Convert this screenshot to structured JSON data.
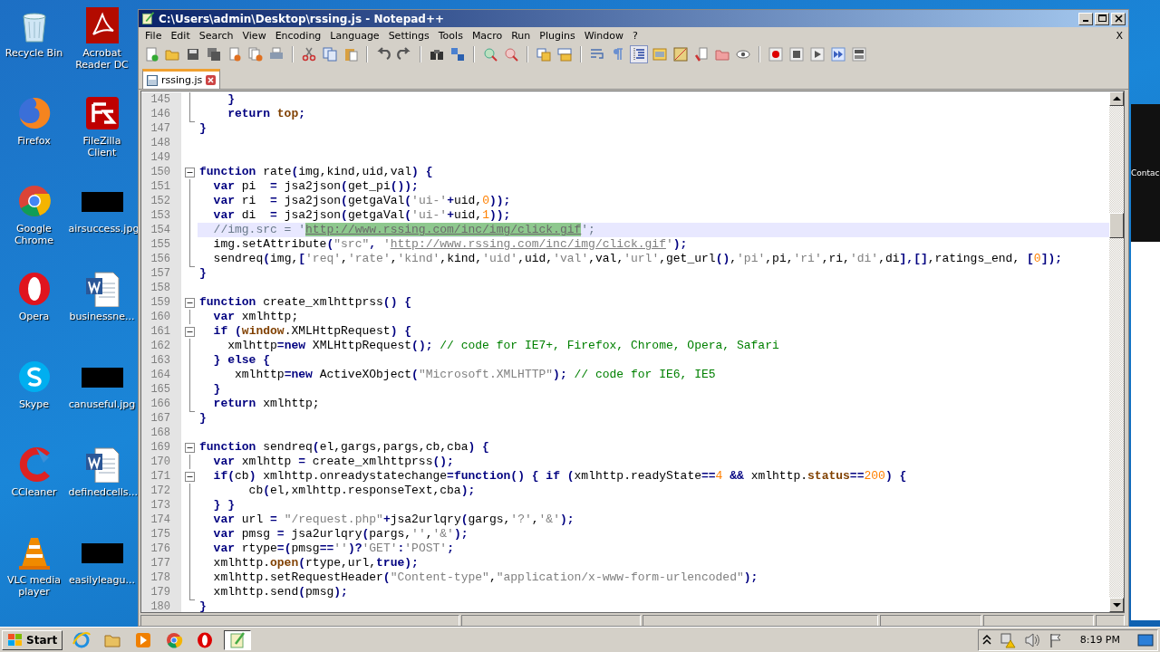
{
  "desktop_icons": [
    {
      "label": "Recycle Bin",
      "kind": "bin"
    },
    {
      "label": "Acrobat Reader DC",
      "kind": "pdf"
    },
    {
      "label": "Firefox",
      "kind": "fox"
    },
    {
      "label": "FileZilla Client",
      "kind": "ftp"
    },
    {
      "label": "Google Chrome",
      "kind": "chrome"
    },
    {
      "label": "airsuccess.jpg",
      "kind": "image"
    },
    {
      "label": "Opera",
      "kind": "opera"
    },
    {
      "label": "businessne...",
      "kind": "doc"
    },
    {
      "label": "Skype",
      "kind": "skype"
    },
    {
      "label": "canuseful.jpg",
      "kind": "image"
    },
    {
      "label": "CCleaner",
      "kind": "cleaner"
    },
    {
      "label": "definedcells...",
      "kind": "doc"
    },
    {
      "label": "VLC media player",
      "kind": "cone"
    },
    {
      "label": "easilyleagu...",
      "kind": "image"
    }
  ],
  "window": {
    "title": "C:\\Users\\admin\\Desktop\\rssing.js - Notepad++"
  },
  "menu": [
    "File",
    "Edit",
    "Search",
    "View",
    "Encoding",
    "Language",
    "Settings",
    "Tools",
    "Macro",
    "Run",
    "Plugins",
    "Window",
    "?"
  ],
  "menu_close": "X",
  "tabs": [
    {
      "label": "rssing.js",
      "selected": true
    }
  ],
  "lines": [
    {
      "num": "145",
      "kind": "tee",
      "current": false,
      "tokens": [
        {
          "kind": "op",
          "text": "    }"
        }
      ]
    },
    {
      "num": "146",
      "kind": "line",
      "current": false,
      "tokens": [
        {
          "kind": "kw",
          "text": "    return"
        },
        {
          "kind": "obj",
          "text": " top"
        },
        {
          "kind": "op",
          "text": ";"
        }
      ]
    },
    {
      "num": "147",
      "kind": "end",
      "current": false,
      "tokens": [
        {
          "kind": "op",
          "text": "}"
        }
      ]
    },
    {
      "num": "148",
      "kind": "none",
      "current": false
    },
    {
      "num": "149",
      "kind": "none",
      "current": false
    },
    {
      "num": "150",
      "kind": "open",
      "current": false,
      "tokens": [
        {
          "kind": "kw",
          "text": "function"
        },
        {
          "kind": "p",
          "text": " rate"
        },
        {
          "kind": "op",
          "text": "("
        },
        {
          "kind": "p",
          "text": "img,kind,uid,val"
        },
        {
          "kind": "op",
          "text": ") {"
        }
      ]
    },
    {
      "num": "151",
      "kind": "line",
      "current": false,
      "tokens": [
        {
          "kind": "kw",
          "text": "  var"
        },
        {
          "kind": "p",
          "text": " pi  "
        },
        {
          "kind": "op",
          "text": "="
        },
        {
          "kind": "p",
          "text": " jsa2json"
        },
        {
          "kind": "op",
          "text": "("
        },
        {
          "kind": "p",
          "text": "get_pi"
        },
        {
          "kind": "op",
          "text": "());"
        }
      ]
    },
    {
      "num": "152",
      "kind": "line",
      "current": false,
      "tokens": [
        {
          "kind": "kw",
          "text": "  var"
        },
        {
          "kind": "p",
          "text": " ri  "
        },
        {
          "kind": "op",
          "text": "="
        },
        {
          "kind": "p",
          "text": " jsa2json"
        },
        {
          "kind": "op",
          "text": "("
        },
        {
          "kind": "p",
          "text": "getgaVal"
        },
        {
          "kind": "op",
          "text": "("
        },
        {
          "kind": "str",
          "text": "'ui-'"
        },
        {
          "kind": "op",
          "text": "+"
        },
        {
          "kind": "p",
          "text": "uid,"
        },
        {
          "kind": "num",
          "text": "0"
        },
        {
          "kind": "op",
          "text": "));"
        }
      ]
    },
    {
      "num": "153",
      "kind": "line",
      "current": false,
      "tokens": [
        {
          "kind": "kw",
          "text": "  var"
        },
        {
          "kind": "p",
          "text": " di  "
        },
        {
          "kind": "op",
          "text": "="
        },
        {
          "kind": "p",
          "text": " jsa2json"
        },
        {
          "kind": "op",
          "text": "("
        },
        {
          "kind": "p",
          "text": "getgaVal"
        },
        {
          "kind": "op",
          "text": "("
        },
        {
          "kind": "str",
          "text": "'ui-'"
        },
        {
          "kind": "op",
          "text": "+"
        },
        {
          "kind": "p",
          "text": "uid,"
        },
        {
          "kind": "num",
          "text": "1"
        },
        {
          "kind": "op",
          "text": "));"
        }
      ]
    },
    {
      "num": "154",
      "kind": "line",
      "current": true,
      "tokens": [
        {
          "kind": "cmt",
          "text": "  //img.src = '"
        },
        {
          "kind": "mark",
          "text": "http://www.rssing.com/inc/img/click.gif"
        },
        {
          "kind": "cmt",
          "text": "';"
        }
      ]
    },
    {
      "num": "155",
      "kind": "line",
      "current": false,
      "tokens": [
        {
          "kind": "p",
          "text": "  img.setAttribute"
        },
        {
          "kind": "op",
          "text": "("
        },
        {
          "kind": "str",
          "text": "\"src\""
        },
        {
          "kind": "op",
          "text": ","
        },
        {
          "kind": "str",
          "text": " '"
        },
        {
          "kind": "url",
          "text": "http://www.rssing.com/inc/img/click.gif"
        },
        {
          "kind": "str",
          "text": "'"
        },
        {
          "kind": "op",
          "text": ");"
        }
      ]
    },
    {
      "num": "156",
      "kind": "line",
      "current": false,
      "tokens": [
        {
          "kind": "p",
          "text": "  sendreq"
        },
        {
          "kind": "op",
          "text": "("
        },
        {
          "kind": "p",
          "text": "img,"
        },
        {
          "kind": "op",
          "text": "["
        },
        {
          "kind": "str",
          "text": "'req'"
        },
        {
          "kind": "p",
          "text": ","
        },
        {
          "kind": "str",
          "text": "'rate'"
        },
        {
          "kind": "p",
          "text": ","
        },
        {
          "kind": "str",
          "text": "'kind'"
        },
        {
          "kind": "p",
          "text": ",kind,"
        },
        {
          "kind": "str",
          "text": "'uid'"
        },
        {
          "kind": "p",
          "text": ",uid,"
        },
        {
          "kind": "str",
          "text": "'val'"
        },
        {
          "kind": "p",
          "text": ",val,"
        },
        {
          "kind": "str",
          "text": "'url'"
        },
        {
          "kind": "p",
          "text": ",get_url"
        },
        {
          "kind": "op",
          "text": "()"
        },
        {
          "kind": "p",
          "text": ","
        },
        {
          "kind": "str",
          "text": "'pi'"
        },
        {
          "kind": "p",
          "text": ",pi,"
        },
        {
          "kind": "str",
          "text": "'ri'"
        },
        {
          "kind": "p",
          "text": ",ri,"
        },
        {
          "kind": "str",
          "text": "'di'"
        },
        {
          "kind": "p",
          "text": ",di"
        },
        {
          "kind": "op",
          "text": "],[]"
        },
        {
          "kind": "p",
          "text": ",ratings_end, "
        },
        {
          "kind": "op",
          "text": "["
        },
        {
          "kind": "num",
          "text": "0"
        },
        {
          "kind": "op",
          "text": "]);"
        }
      ]
    },
    {
      "num": "157",
      "kind": "end",
      "current": false,
      "tokens": [
        {
          "kind": "op",
          "text": "}"
        }
      ]
    },
    {
      "num": "158",
      "kind": "none",
      "current": false
    },
    {
      "num": "159",
      "kind": "open",
      "current": false,
      "tokens": [
        {
          "kind": "kw",
          "text": "function"
        },
        {
          "kind": "p",
          "text": " create_xmlhttprss"
        },
        {
          "kind": "op",
          "text": "() {"
        }
      ]
    },
    {
      "num": "160",
      "kind": "line",
      "current": false,
      "tokens": [
        {
          "kind": "kw",
          "text": "  var"
        },
        {
          "kind": "p",
          "text": " xmlhttp;"
        }
      ]
    },
    {
      "num": "161",
      "kind": "open",
      "current": false,
      "tokens": [
        {
          "kind": "kw",
          "text": "  if"
        },
        {
          "kind": "op",
          "text": " ("
        },
        {
          "kind": "obj",
          "text": "window"
        },
        {
          "kind": "p",
          "text": ".XMLHttpRequest"
        },
        {
          "kind": "op",
          "text": ") {"
        }
      ]
    },
    {
      "num": "162",
      "kind": "line",
      "current": false,
      "tokens": [
        {
          "kind": "p",
          "text": "    xmlhttp"
        },
        {
          "kind": "op",
          "text": "="
        },
        {
          "kind": "kw",
          "text": "new"
        },
        {
          "kind": "p",
          "text": " XMLHttpRequest"
        },
        {
          "kind": "op",
          "text": "();"
        },
        {
          "kind": "cmt",
          "text": " // code for IE7+, Firefox, Chrome, Opera, Safari"
        }
      ]
    },
    {
      "num": "163",
      "kind": "line",
      "current": false,
      "tokens": [
        {
          "kind": "op",
          "text": "  }"
        },
        {
          "kind": "kw",
          "text": " else"
        },
        {
          "kind": "op",
          "text": " {"
        }
      ]
    },
    {
      "num": "164",
      "kind": "line",
      "current": false,
      "tokens": [
        {
          "kind": "p",
          "text": "     xmlhttp"
        },
        {
          "kind": "op",
          "text": "="
        },
        {
          "kind": "kw",
          "text": "new"
        },
        {
          "kind": "p",
          "text": " ActiveXObject"
        },
        {
          "kind": "op",
          "text": "("
        },
        {
          "kind": "str",
          "text": "\"Microsoft.XMLHTTP\""
        },
        {
          "kind": "op",
          "text": ");"
        },
        {
          "kind": "cmt",
          "text": " // code for IE6, IE5"
        }
      ]
    },
    {
      "num": "165",
      "kind": "tee",
      "current": false,
      "tokens": [
        {
          "kind": "op",
          "text": "  }"
        }
      ]
    },
    {
      "num": "166",
      "kind": "line",
      "current": false,
      "tokens": [
        {
          "kind": "kw",
          "text": "  return"
        },
        {
          "kind": "p",
          "text": " xmlhttp;"
        }
      ]
    },
    {
      "num": "167",
      "kind": "end",
      "current": false,
      "tokens": [
        {
          "kind": "op",
          "text": "}"
        }
      ]
    },
    {
      "num": "168",
      "kind": "none",
      "current": false
    },
    {
      "num": "169",
      "kind": "open",
      "current": false,
      "tokens": [
        {
          "kind": "kw",
          "text": "function"
        },
        {
          "kind": "p",
          "text": " sendreq"
        },
        {
          "kind": "op",
          "text": "("
        },
        {
          "kind": "p",
          "text": "el,gargs,pargs,cb,cba"
        },
        {
          "kind": "op",
          "text": ") {"
        }
      ]
    },
    {
      "num": "170",
      "kind": "line",
      "current": false,
      "tokens": [
        {
          "kind": "kw",
          "text": "  var"
        },
        {
          "kind": "p",
          "text": " xmlhttp "
        },
        {
          "kind": "op",
          "text": "="
        },
        {
          "kind": "p",
          "text": " create_xmlhttprss"
        },
        {
          "kind": "op",
          "text": "();"
        }
      ]
    },
    {
      "num": "171",
      "kind": "open",
      "current": false,
      "tokens": [
        {
          "kind": "kw",
          "text": "  if"
        },
        {
          "kind": "op",
          "text": "("
        },
        {
          "kind": "p",
          "text": "cb"
        },
        {
          "kind": "op",
          "text": ")"
        },
        {
          "kind": "p",
          "text": " xmlhttp.onreadystatechange"
        },
        {
          "kind": "op",
          "text": "="
        },
        {
          "kind": "kw",
          "text": "function"
        },
        {
          "kind": "op",
          "text": "() {"
        },
        {
          "kind": "kw",
          "text": " if"
        },
        {
          "kind": "op",
          "text": " ("
        },
        {
          "kind": "p",
          "text": "xmlhttp.readyState"
        },
        {
          "kind": "op",
          "text": "=="
        },
        {
          "kind": "num",
          "text": "4"
        },
        {
          "kind": "op",
          "text": " &&"
        },
        {
          "kind": "p",
          "text": " xmlhttp."
        },
        {
          "kind": "obj",
          "text": "status"
        },
        {
          "kind": "op",
          "text": "=="
        },
        {
          "kind": "num",
          "text": "200"
        },
        {
          "kind": "op",
          "text": ") {"
        }
      ]
    },
    {
      "num": "172",
      "kind": "line",
      "current": false,
      "tokens": [
        {
          "kind": "p",
          "text": "       cb"
        },
        {
          "kind": "op",
          "text": "("
        },
        {
          "kind": "p",
          "text": "el,xmlhttp.responseText,cba"
        },
        {
          "kind": "op",
          "text": ");"
        }
      ]
    },
    {
      "num": "173",
      "kind": "tee",
      "current": false,
      "tokens": [
        {
          "kind": "op",
          "text": "  } }"
        }
      ]
    },
    {
      "num": "174",
      "kind": "line",
      "current": false,
      "tokens": [
        {
          "kind": "kw",
          "text": "  var"
        },
        {
          "kind": "p",
          "text": " url "
        },
        {
          "kind": "op",
          "text": "="
        },
        {
          "kind": "str",
          "text": " \"/request.php\""
        },
        {
          "kind": "op",
          "text": "+"
        },
        {
          "kind": "p",
          "text": "jsa2urlqry"
        },
        {
          "kind": "op",
          "text": "("
        },
        {
          "kind": "p",
          "text": "gargs,"
        },
        {
          "kind": "str",
          "text": "'?'"
        },
        {
          "kind": "p",
          "text": ","
        },
        {
          "kind": "str",
          "text": "'&'"
        },
        {
          "kind": "op",
          "text": ");"
        }
      ]
    },
    {
      "num": "175",
      "kind": "line",
      "current": false,
      "tokens": [
        {
          "kind": "kw",
          "text": "  var"
        },
        {
          "kind": "p",
          "text": " pmsg "
        },
        {
          "kind": "op",
          "text": "="
        },
        {
          "kind": "p",
          "text": " jsa2urlqry"
        },
        {
          "kind": "op",
          "text": "("
        },
        {
          "kind": "p",
          "text": "pargs,"
        },
        {
          "kind": "str",
          "text": "''"
        },
        {
          "kind": "p",
          "text": ","
        },
        {
          "kind": "str",
          "text": "'&'"
        },
        {
          "kind": "op",
          "text": ");"
        }
      ]
    },
    {
      "num": "176",
      "kind": "line",
      "current": false,
      "tokens": [
        {
          "kind": "kw",
          "text": "  var"
        },
        {
          "kind": "p",
          "text": " rtype"
        },
        {
          "kind": "op",
          "text": "=("
        },
        {
          "kind": "p",
          "text": "pmsg"
        },
        {
          "kind": "op",
          "text": "=="
        },
        {
          "kind": "str",
          "text": "''"
        },
        {
          "kind": "op",
          "text": ")?"
        },
        {
          "kind": "str",
          "text": "'GET'"
        },
        {
          "kind": "op",
          "text": ":"
        },
        {
          "kind": "str",
          "text": "'POST'"
        },
        {
          "kind": "op",
          "text": ";"
        }
      ]
    },
    {
      "num": "177",
      "kind": "line",
      "current": false,
      "tokens": [
        {
          "kind": "p",
          "text": "  xmlhttp."
        },
        {
          "kind": "obj",
          "text": "open"
        },
        {
          "kind": "op",
          "text": "("
        },
        {
          "kind": "p",
          "text": "rtype,url,"
        },
        {
          "kind": "kw",
          "text": "true"
        },
        {
          "kind": "op",
          "text": ");"
        }
      ]
    },
    {
      "num": "178",
      "kind": "line",
      "current": false,
      "tokens": [
        {
          "kind": "p",
          "text": "  xmlhttp.setRequestHeader"
        },
        {
          "kind": "op",
          "text": "("
        },
        {
          "kind": "str",
          "text": "\"Content-type\""
        },
        {
          "kind": "p",
          "text": ","
        },
        {
          "kind": "str",
          "text": "\"application/x-www-form-urlencoded\""
        },
        {
          "kind": "op",
          "text": ");"
        }
      ]
    },
    {
      "num": "179",
      "kind": "line",
      "current": false,
      "tokens": [
        {
          "kind": "p",
          "text": "  xmlhttp.send"
        },
        {
          "kind": "op",
          "text": "("
        },
        {
          "kind": "p",
          "text": "pmsg"
        },
        {
          "kind": "op",
          "text": ");"
        }
      ]
    },
    {
      "num": "180",
      "kind": "end",
      "current": false,
      "tokens": [
        {
          "kind": "op",
          "text": "}"
        }
      ]
    }
  ],
  "background_window": {
    "text": "Contac"
  },
  "taskbar": {
    "start": "Start",
    "apps": [
      {
        "kind": "ie",
        "selected": false
      },
      {
        "kind": "folder",
        "selected": false
      },
      {
        "kind": "media",
        "selected": false
      },
      {
        "kind": "chrome",
        "selected": false
      },
      {
        "kind": "opera",
        "selected": false
      },
      {
        "kind": "notepad",
        "selected": true
      }
    ],
    "clock": "8:19 PM"
  }
}
